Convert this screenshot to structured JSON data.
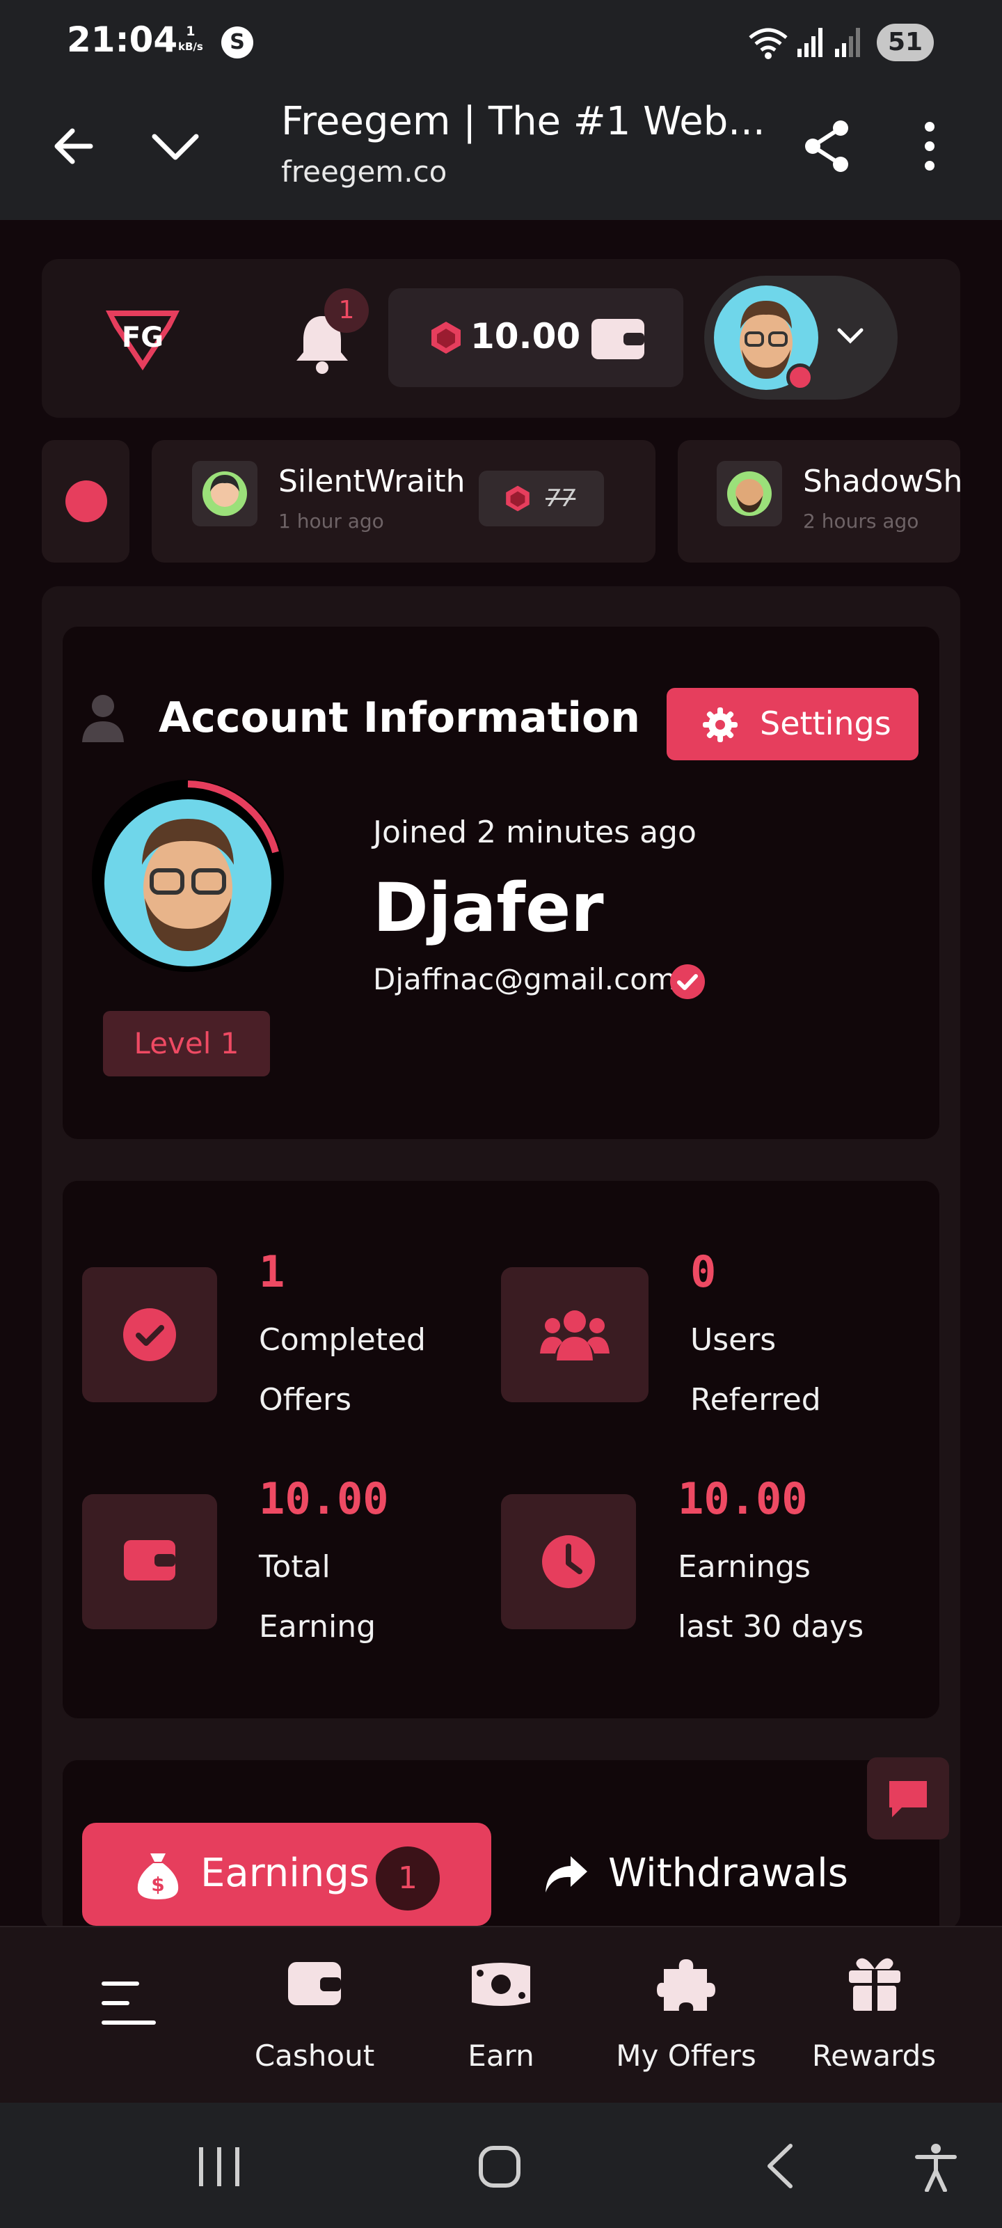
{
  "status_bar": {
    "time": "21:04",
    "speed_value": "1",
    "speed_unit": "kB/s",
    "app_icon": "S",
    "battery": "51"
  },
  "browser": {
    "page_title": "Freegem | The #1 Web...",
    "url": "freegem.co"
  },
  "header": {
    "notification_count": "1",
    "balance": "10.00"
  },
  "ticker": [
    {
      "name": "SilentWraith",
      "time_ago": "1 hour ago",
      "amount": "77"
    },
    {
      "name": "ShadowSha",
      "time_ago": "2 hours ago"
    }
  ],
  "account": {
    "title": "Account Information",
    "settings_label": "Settings",
    "joined": "Joined 2 minutes ago",
    "username": "Djafer",
    "email": "Djaffnac@gmail.com",
    "level": "Level 1"
  },
  "stats": [
    {
      "value": "1",
      "label_line1": "Completed",
      "label_line2": "Offers"
    },
    {
      "value": "0",
      "label_line1": "Users",
      "label_line2": "Referred"
    },
    {
      "value": "10.00",
      "label_line1": "Total",
      "label_line2": "Earning"
    },
    {
      "value": "10.00",
      "label_line1": "Earnings",
      "label_line2": "last 30 days"
    }
  ],
  "tabs": {
    "earnings_label": "Earnings",
    "earnings_count": "1",
    "withdrawals_label": "Withdrawals"
  },
  "bottom_nav": {
    "items": [
      {
        "label": "Cashout",
        "icon": "wallet-icon"
      },
      {
        "label": "Earn",
        "icon": "money-icon"
      },
      {
        "label": "My Offers",
        "icon": "puzzle-icon"
      },
      {
        "label": "Rewards",
        "icon": "gift-icon"
      }
    ]
  },
  "colors": {
    "accent": "#e63e5d",
    "background": "#12080c",
    "panel": "#1d1316",
    "card": "#11070a"
  }
}
